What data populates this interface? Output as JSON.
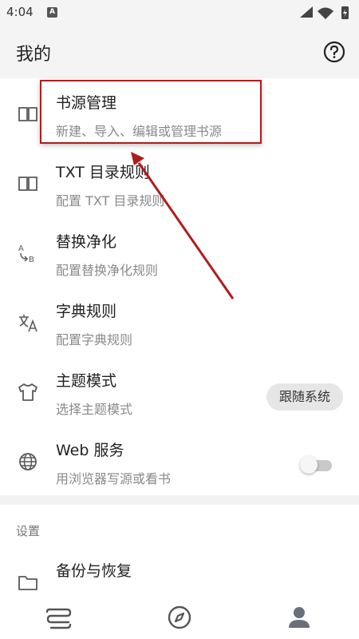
{
  "status_bar": {
    "time": "4:04",
    "notification_badge": "A"
  },
  "app_bar": {
    "title": "我的",
    "help_icon": "help-circle-icon"
  },
  "items": [
    {
      "label": "书源管理",
      "sub": "新建、导入、编辑或管理书源",
      "icon": "book-open-icon"
    },
    {
      "label": "TXT 目录规则",
      "sub": "配置 TXT 目录规则",
      "icon": "book-open-icon"
    },
    {
      "label": "替换净化",
      "sub": "配置替换净化规则",
      "icon": "replace-ab-icon"
    },
    {
      "label": "字典规则",
      "sub": "配置字典规则",
      "icon": "translate-icon"
    },
    {
      "label": "主题模式",
      "sub": "选择主题模式",
      "icon": "tshirt-icon",
      "value": "跟随系统"
    },
    {
      "label": "Web 服务",
      "sub": "用浏览器写源或看书",
      "icon": "globe-icon",
      "toggle_on": false
    }
  ],
  "settings": {
    "section_label": "设置",
    "backup_label": "备份与恢复",
    "backup_icon": "folder-icon"
  },
  "bottom_nav": [
    {
      "name": "bookshelf",
      "icon": "bookshelf-icon"
    },
    {
      "name": "discover",
      "icon": "compass-icon"
    },
    {
      "name": "my",
      "icon": "person-icon",
      "active": true
    }
  ],
  "colors": {
    "annotation": "#b01c1c",
    "icon": "#5a5a5a",
    "pill_bg": "#e6e6e6"
  }
}
